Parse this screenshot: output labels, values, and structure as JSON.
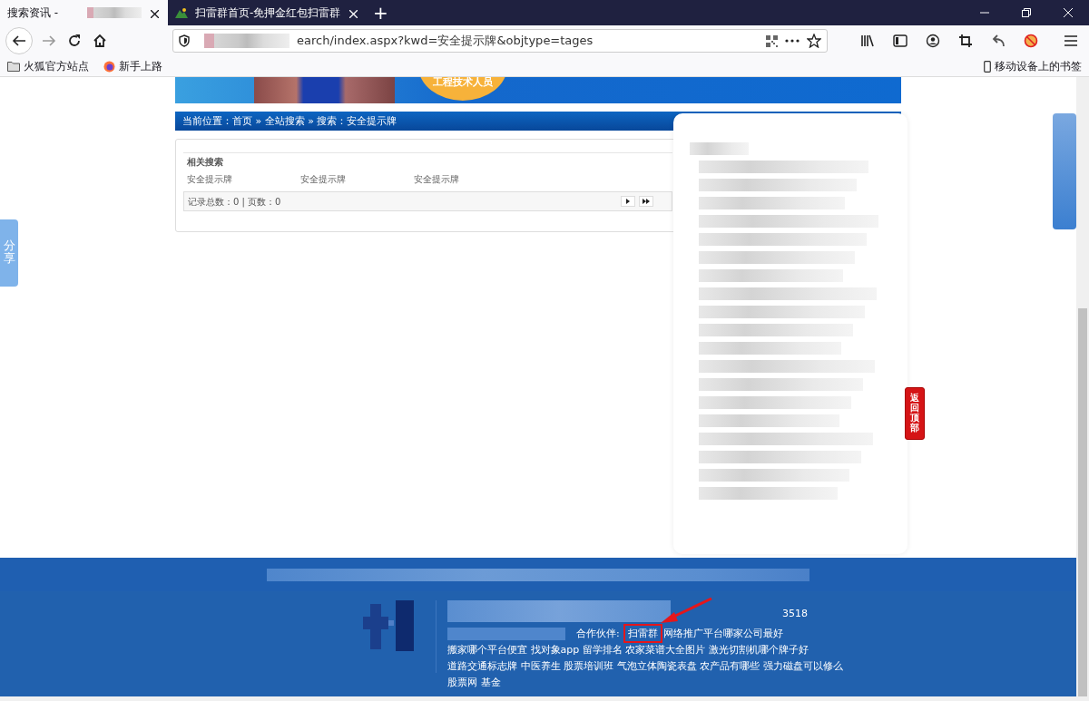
{
  "browser": {
    "tabs": [
      {
        "title": "搜索资讯 -",
        "selected": true
      },
      {
        "title": "扫雷群首页-免押金红包扫雷群",
        "selected": false
      }
    ],
    "new_tab": "+",
    "address": "earch/index.aspx?kwd=安全提示牌&objtype=tages",
    "bookmarks": [
      "火狐官方站点",
      "新手上路"
    ],
    "mobile_bookmarks": "移动设备上的书签"
  },
  "banner": {
    "caption": "工程技术人员"
  },
  "breadcrumb": "当前位置：首页 » 全站搜索 » 搜索：安全提示牌",
  "related": {
    "title": "相关搜索",
    "items": [
      "安全提示牌",
      "安全提示牌",
      "安全提示牌"
    ]
  },
  "pager": {
    "summary": "记录总数：0 | 页数：0"
  },
  "side_buttons": {
    "share": "分享",
    "back_to_top": "返回顶部"
  },
  "footer": {
    "number_tail": "3518",
    "partners_label": "合作伙伴:",
    "partners": [
      {
        "text": "扫雷群",
        "highlighted": true
      },
      {
        "text": "网络推广平台哪家公司最好",
        "highlighted": false
      },
      {
        "text": "搬家哪个平台便宜",
        "highlighted": false
      },
      {
        "text": "找对象app",
        "highlighted": false
      },
      {
        "text": "留学排名",
        "highlighted": false
      },
      {
        "text": "农家菜谱大全图片",
        "highlighted": false
      },
      {
        "text": "激光切割机哪个牌子好",
        "highlighted": false
      },
      {
        "text": "道路交通标志牌",
        "highlighted": false
      },
      {
        "text": "中医养生",
        "highlighted": false
      },
      {
        "text": "股票培训班",
        "highlighted": false
      },
      {
        "text": "气泡立体陶瓷表盘",
        "highlighted": false
      },
      {
        "text": "农产品有哪些",
        "highlighted": false
      },
      {
        "text": "强力磁盘可以修么",
        "highlighted": false
      },
      {
        "text": "股票网",
        "highlighted": false
      },
      {
        "text": "基金",
        "highlighted": false
      }
    ]
  }
}
